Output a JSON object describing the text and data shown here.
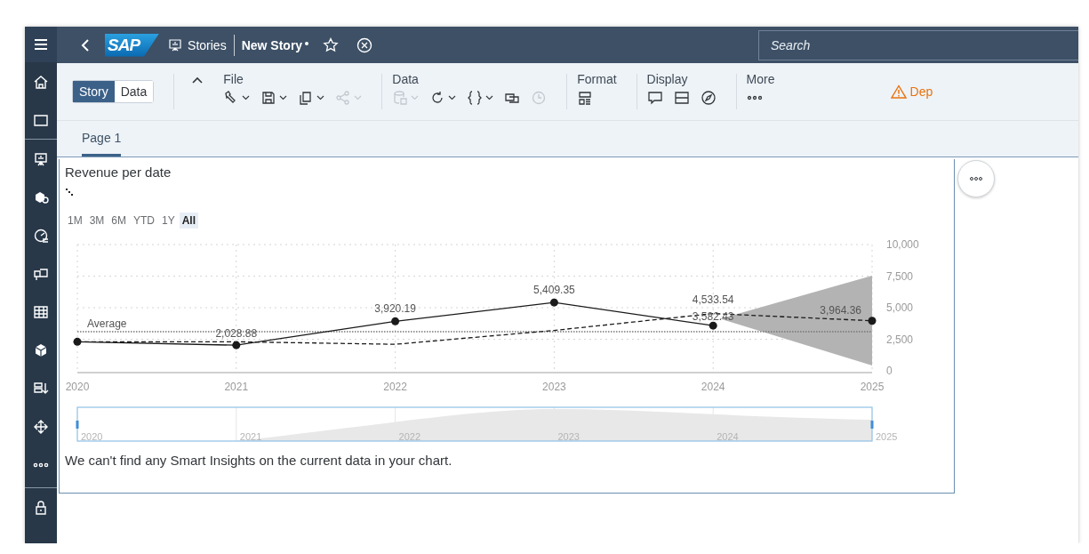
{
  "header": {
    "logo": "SAP",
    "breadcrumb": "Stories",
    "title": "New Story",
    "unsaved": true,
    "search": {
      "placeholder": "Search"
    }
  },
  "toolbar": {
    "modes": [
      {
        "label": "Story",
        "selected": true
      },
      {
        "label": "Data",
        "selected": false
      }
    ],
    "groups": [
      {
        "label": "File",
        "items": [
          {
            "kind": "wrench",
            "dropdown": true,
            "disabled": false
          },
          {
            "kind": "save",
            "dropdown": true,
            "disabled": false
          },
          {
            "kind": "copy",
            "dropdown": true,
            "disabled": false
          },
          {
            "kind": "share",
            "dropdown": true,
            "disabled": true
          }
        ]
      },
      {
        "label": "Data",
        "items": [
          {
            "kind": "database",
            "dropdown": true,
            "disabled": true
          },
          {
            "kind": "refresh",
            "dropdown": true,
            "disabled": false
          },
          {
            "kind": "braces",
            "dropdown": true,
            "disabled": false
          },
          {
            "kind": "duplicate",
            "dropdown": false,
            "disabled": false
          },
          {
            "kind": "history",
            "dropdown": false,
            "disabled": true
          }
        ]
      },
      {
        "label": "Format",
        "items": [
          {
            "kind": "layout",
            "dropdown": false,
            "disabled": false
          }
        ]
      },
      {
        "label": "Display",
        "items": [
          {
            "kind": "comment",
            "dropdown": false,
            "disabled": false
          },
          {
            "kind": "panel",
            "dropdown": false,
            "disabled": false
          },
          {
            "kind": "compass",
            "dropdown": false,
            "disabled": false
          }
        ]
      },
      {
        "label": "More",
        "items": [
          {
            "kind": "ellipsis",
            "dropdown": false,
            "disabled": false
          }
        ]
      }
    ],
    "warning": "Dep"
  },
  "pages": [
    {
      "label": "Page 1",
      "selected": true
    }
  ],
  "widget": {
    "title": "Revenue per date",
    "ranges": [
      {
        "label": "1M",
        "selected": false
      },
      {
        "label": "3M",
        "selected": false
      },
      {
        "label": "6M",
        "selected": false
      },
      {
        "label": "YTD",
        "selected": false
      },
      {
        "label": "1Y",
        "selected": false
      },
      {
        "label": "All",
        "selected": true
      }
    ],
    "chart_data": {
      "type": "line",
      "categories": [
        "2020",
        "2021",
        "2022",
        "2023",
        "2024",
        "2025"
      ],
      "series": [
        {
          "color": "#1a1a1a",
          "marker": "circle",
          "values": [
            2300,
            2028.88,
            3920.19,
            5409.35,
            3582.43,
            null
          ],
          "value_labels": [
            null,
            "2,028.88",
            "3,920.19",
            "5,409.35",
            "3,582.43",
            null
          ]
        },
        {
          "color": "#1a1a1a",
          "line_style": "dashed",
          "values": [
            2300,
            2300,
            2100,
            3200,
            4533.54,
            3964.36
          ],
          "value_labels": [
            null,
            null,
            null,
            null,
            "4,533.54",
            "3,964.36"
          ]
        }
      ],
      "ylim": [
        0,
        10000
      ],
      "grid": true,
      "yticks": [
        {
          "value": 0,
          "label": "0"
        },
        {
          "value": 2500,
          "label": "2,500"
        },
        {
          "value": 5000,
          "label": "5,000"
        },
        {
          "value": 7500,
          "label": "7,500"
        },
        {
          "value": 10000,
          "label": "10,000"
        }
      ],
      "ref_lines": [
        {
          "axis": "y",
          "value": 3100,
          "label": "Average"
        }
      ]
    },
    "navigator": {
      "labels": [
        "2020",
        "2021",
        "2022",
        "2023",
        "2024",
        "2025"
      ]
    },
    "insight": "We can't find any Smart Insights on the current data in your chart."
  }
}
